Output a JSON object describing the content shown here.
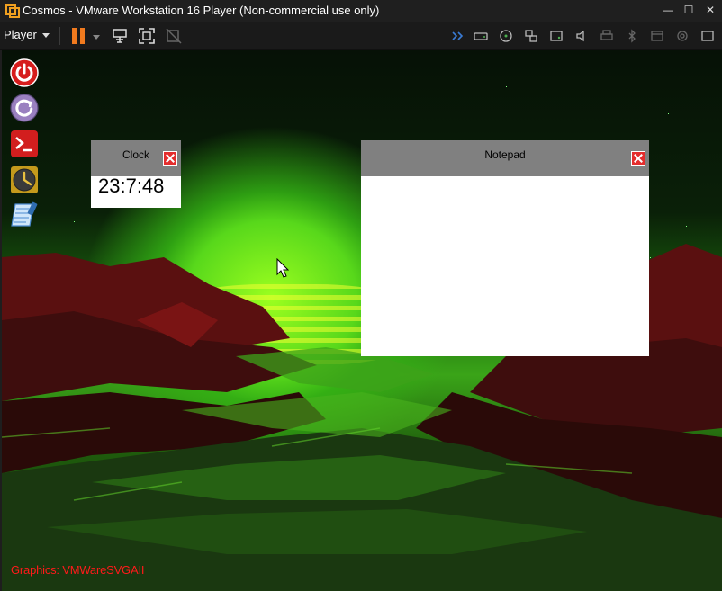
{
  "window": {
    "title": "Cosmos - VMware Workstation 16 Player (Non-commercial use only)",
    "minimize": "—",
    "maximize": "☐",
    "close": "✕"
  },
  "toolbar": {
    "player_label": "Player",
    "accent": "#f07a1e"
  },
  "desktop": {
    "dock": [
      "power-icon",
      "restart-icon",
      "terminal-icon",
      "clock-app-icon",
      "notepad-app-icon"
    ],
    "clock_window": {
      "title": "Clock",
      "time": "23:7:48"
    },
    "notepad_window": {
      "title": "Notepad",
      "content": ""
    },
    "status_text": "Graphics: VMWareSVGAII",
    "status_color": "#ff1a1a"
  }
}
